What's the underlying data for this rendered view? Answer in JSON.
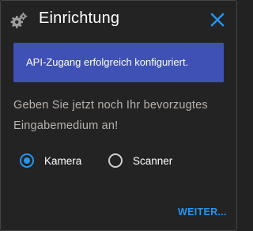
{
  "dialog": {
    "title": "Einrichtung",
    "header_icon": "gear-icon",
    "close_icon": "close-icon",
    "accent_color": "#2196f3"
  },
  "banner": {
    "message": "API-Zugang erfolgreich konfiguriert.",
    "background": "#3f51b5"
  },
  "prompt": {
    "text": "Geben Sie jetzt noch Ihr bevorzugtes Eingabemedium an!"
  },
  "input_medium": {
    "options": [
      {
        "label": "Kamera",
        "checked": true
      },
      {
        "label": "Scanner",
        "checked": false
      }
    ],
    "selected": "Kamera"
  },
  "actions": {
    "next_label": "WEITER..."
  }
}
